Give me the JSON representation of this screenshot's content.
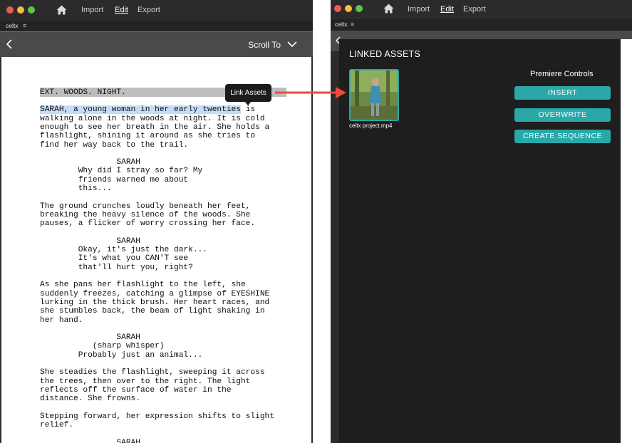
{
  "left_window": {
    "menu": {
      "import": "Import",
      "edit": "Edit",
      "export": "Export"
    },
    "tab": {
      "label": "celtx",
      "menu_glyph": "≡"
    },
    "toolbar": {
      "scroll_to": "Scroll To"
    },
    "script_lines": [
      {
        "text": "EXT. WOODS. NIGHT.",
        "kind": "heading"
      },
      {
        "text": "SARAH, a young woman in her early twenties",
        "kind": "highlight",
        "rest": " is"
      },
      {
        "text": "walking alone in the woods at night. It is cold"
      },
      {
        "text": "enough to see her breath in the air. She holds a"
      },
      {
        "text": "flashlight, shining it around as she tries to"
      },
      {
        "text": "find her way back to the trail."
      },
      {
        "text": ""
      },
      {
        "text": "                SARAH"
      },
      {
        "text": "        Why did I stray so far? My"
      },
      {
        "text": "        friends warned me about"
      },
      {
        "text": "        this..."
      },
      {
        "text": ""
      },
      {
        "text": "The ground crunches loudly beneath her feet,"
      },
      {
        "text": "breaking the heavy silence of the woods. She"
      },
      {
        "text": "pauses, a flicker of worry crossing her face."
      },
      {
        "text": ""
      },
      {
        "text": "                SARAH"
      },
      {
        "text": "        Okay, it's just the dark..."
      },
      {
        "text": "        It's what you CAN'T see"
      },
      {
        "text": "        that'll hurt you, right?"
      },
      {
        "text": ""
      },
      {
        "text": "As she pans her flashlight to the left, she"
      },
      {
        "text": "suddenly freezes, catching a glimpse of EYESHINE"
      },
      {
        "text": "lurking in the thick brush. Her heart races, and"
      },
      {
        "text": "she stumbles back, the beam of light shaking in"
      },
      {
        "text": "her hand."
      },
      {
        "text": ""
      },
      {
        "text": "                SARAH"
      },
      {
        "text": "           (sharp whisper)"
      },
      {
        "text": "        Probably just an animal..."
      },
      {
        "text": ""
      },
      {
        "text": "She steadies the flashlight, sweeping it across"
      },
      {
        "text": "the trees, then over to the right. The light"
      },
      {
        "text": "reflects off the surface of water in the"
      },
      {
        "text": "distance. She frowns."
      },
      {
        "text": ""
      },
      {
        "text": "Stepping forward, her expression shifts to slight"
      },
      {
        "text": "relief."
      },
      {
        "text": ""
      },
      {
        "text": "                SARAH"
      }
    ],
    "tooltip": "Link Assets"
  },
  "right_window": {
    "menu": {
      "import": "Import",
      "edit": "Edit",
      "export": "Export"
    },
    "tab": {
      "label": "celtx",
      "menu_glyph": "≡"
    },
    "panel": {
      "title": "LINKED ASSETS",
      "asset_name": "celtx project.mp4",
      "controls_title": "Premiere Controls",
      "buttons": [
        "INSERT",
        "OVERWRITE",
        "CREATE SEQUENCE"
      ]
    }
  },
  "colors": {
    "accent_teal": "#2aa8a8",
    "arrow_red": "#ef4b3c",
    "highlight_blue": "#c5dcf8",
    "heading_gray": "#bdbdbd"
  },
  "icons": [
    "home-icon",
    "hamburger-menu-icon",
    "chevron-left-icon",
    "chevron-down-icon"
  ]
}
